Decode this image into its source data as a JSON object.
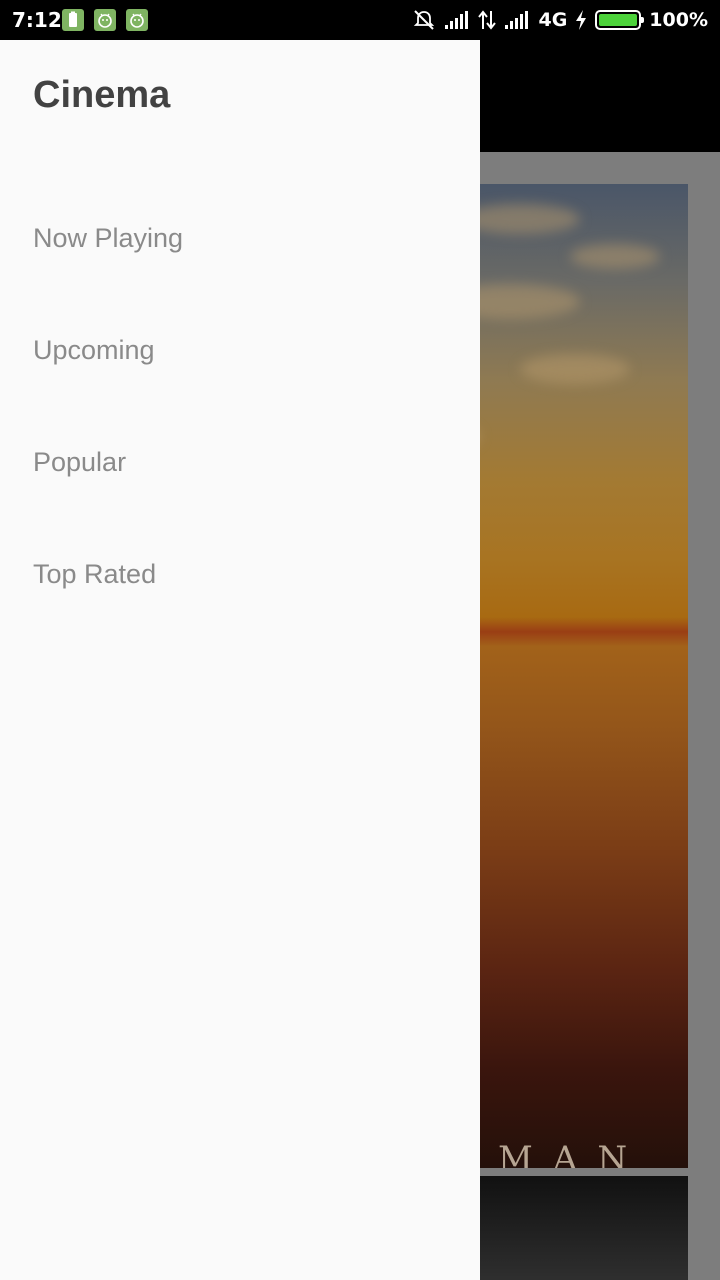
{
  "status_bar": {
    "time": "7:12",
    "network": "4G",
    "battery_percent": "100%",
    "battery_level": 1.0,
    "icons": [
      "battery-notification-icon",
      "android-notification-icon",
      "android-notification-icon",
      "alarm-off-icon",
      "signal-icon",
      "data-transfer-icon",
      "signal-icon",
      "charging-icon"
    ]
  },
  "drawer": {
    "title": "Cinema",
    "items": [
      {
        "label": "Now Playing"
      },
      {
        "label": "Upcoming"
      },
      {
        "label": "Popular"
      },
      {
        "label": "Top Rated"
      }
    ]
  },
  "background": {
    "poster_text": "MAN"
  },
  "colors": {
    "drawer_bg": "#fafafa",
    "title_color": "#424242",
    "item_color": "#8a8a8a",
    "battery_green": "#4cd23a"
  }
}
